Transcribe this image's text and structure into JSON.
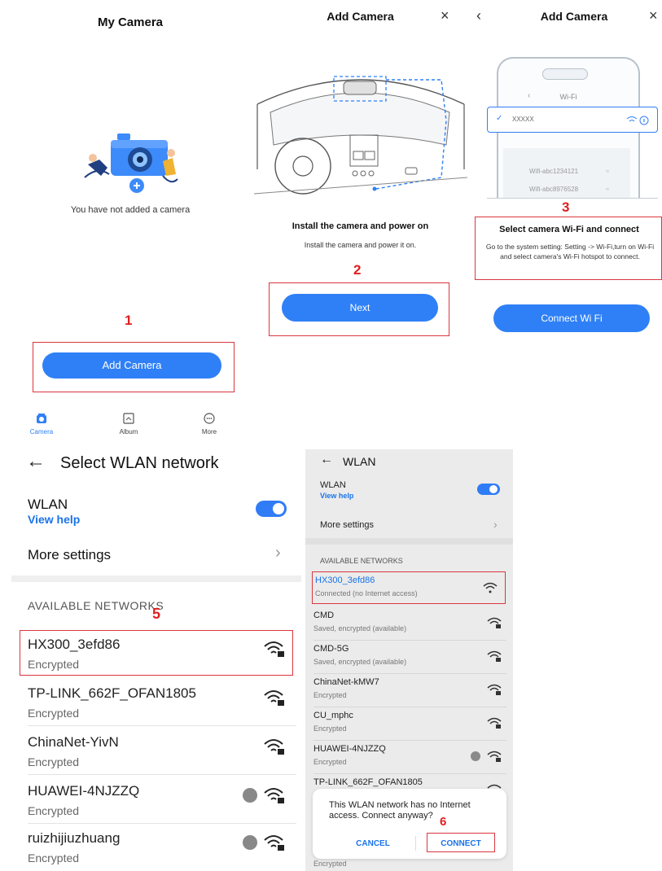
{
  "screen1": {
    "title": "My Camera",
    "empty_text": "You have not added a camera",
    "step": "1",
    "add_button": "Add Camera",
    "nav": [
      {
        "label": "Camera",
        "icon": "camera-icon",
        "active": true
      },
      {
        "label": "Album",
        "icon": "album-icon",
        "active": false
      },
      {
        "label": "More",
        "icon": "more-icon",
        "active": false
      }
    ]
  },
  "screen2": {
    "title": "Add Camera",
    "close": "×",
    "heading": "Install the camera and power on",
    "body": "Install the camera and power it on.",
    "step": "2",
    "next_button": "Next"
  },
  "screen3": {
    "back": "‹",
    "title": "Add Camera",
    "close": "×",
    "phone_header": "Wi-Fi",
    "phone_selected": "XXXXX",
    "phone_list": [
      "Wifi-abc1234121",
      "Wifi-abc8976528"
    ],
    "step": "3",
    "heading": "Select camera Wi-Fi and connect",
    "body": "Go to the system setting: Setting -> Wi-Fi,turn on Wi-Fi and select camera's Wi-Fi hotspot to connect.",
    "connect_button": "Connect Wi Fi"
  },
  "screen4": {
    "back": "←",
    "title": "Select WLAN network",
    "wlan_label": "WLAN",
    "view_help": "View help",
    "more_settings": "More settings",
    "section": "AVAILABLE NETWORKS",
    "step": "5",
    "networks": [
      {
        "name": "HX300_3efd86",
        "status": "Encrypted"
      },
      {
        "name": "TP-LINK_662F_OFAN1805",
        "status": "Encrypted"
      },
      {
        "name": "ChinaNet-YivN",
        "status": "Encrypted"
      },
      {
        "name": "HUAWEI-4NJZZQ",
        "status": "Encrypted"
      },
      {
        "name": "ruizhijiuzhuang",
        "status": "Encrypted"
      }
    ]
  },
  "screen5": {
    "back": "←",
    "title": "WLAN",
    "wlan_label": "WLAN",
    "view_help": "View help",
    "more_settings": "More settings",
    "section": "AVAILABLE NETWORKS",
    "networks": [
      {
        "name": "HX300_3efd86",
        "status": "Connected (no Internet access)"
      },
      {
        "name": "CMD",
        "status": "Saved, encrypted (available)"
      },
      {
        "name": "CMD-5G",
        "status": "Saved, encrypted (available)"
      },
      {
        "name": "ChinaNet-kMW7",
        "status": "Encrypted"
      },
      {
        "name": "CU_mphc",
        "status": "Encrypted"
      },
      {
        "name": "HUAWEI-4NJZZQ",
        "status": "Encrypted"
      },
      {
        "name": "TP-LINK_662F_OFAN1805",
        "status": ""
      }
    ],
    "bottom_status": "Encrypted",
    "dialog": {
      "message": "This WLAN network has no Internet access. Connect anyway?",
      "step": "6",
      "cancel": "CANCEL",
      "connect": "CONNECT"
    }
  },
  "colors": {
    "accent": "#2f80f6",
    "highlight": "#d9363e",
    "link": "#1a73e8"
  }
}
